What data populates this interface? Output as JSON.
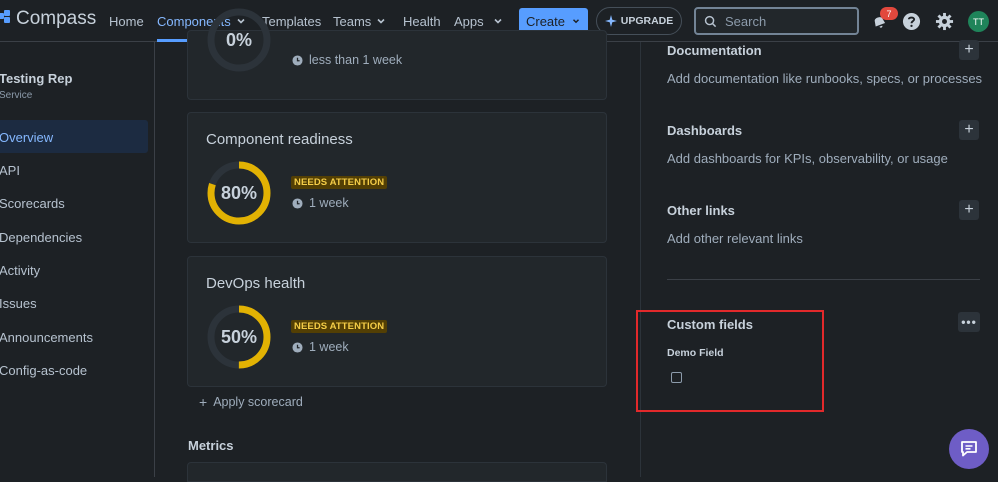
{
  "app": {
    "name": "Compass"
  },
  "nav": {
    "home": "Home",
    "components": "Components",
    "templates": "Templates",
    "teams": "Teams",
    "health": "Health",
    "apps": "Apps",
    "create": "Create",
    "upgrade": "UPGRADE",
    "search_placeholder": "Search",
    "notifications_count": "7",
    "avatar_initials": "TT"
  },
  "sidebar": {
    "component_name": "Testing Rep",
    "component_type": "Service",
    "items": [
      {
        "label": "Overview",
        "active": true
      },
      {
        "label": "API"
      },
      {
        "label": "Scorecards"
      },
      {
        "label": "Dependencies"
      },
      {
        "label": "Activity"
      },
      {
        "label": "Issues"
      },
      {
        "label": "Announcements"
      },
      {
        "label": "Config-as-code"
      }
    ]
  },
  "scorecards": {
    "top_partial": {
      "score": "0%",
      "score_value": 0,
      "time": "less than 1 week"
    },
    "items": [
      {
        "title": "Component readiness",
        "score": "80%",
        "score_value": 80,
        "status": "NEEDS ATTENTION",
        "time": "1 week",
        "color": "#e2b203"
      },
      {
        "title": "DevOps health",
        "score": "50%",
        "score_value": 50,
        "status": "NEEDS ATTENTION",
        "time": "1 week",
        "color": "#e2b203"
      }
    ],
    "apply_label": "Apply scorecard"
  },
  "metrics": {
    "heading": "Metrics"
  },
  "links": {
    "documentation": {
      "title": "Documentation",
      "desc": "Add documentation like runbooks, specs, or processes"
    },
    "dashboards": {
      "title": "Dashboards",
      "desc": "Add dashboards for KPIs, observability, or usage"
    },
    "other": {
      "title": "Other links",
      "desc": "Add other relevant links"
    }
  },
  "custom_fields": {
    "title": "Custom fields",
    "field_label": "Demo Field",
    "field_checked": false
  },
  "colors": {
    "accent": "#579dff",
    "ring_track": "#2c333a",
    "warning": "#e2b203",
    "highlight_box": "#e2292b",
    "fab": "#6e5dc6"
  }
}
